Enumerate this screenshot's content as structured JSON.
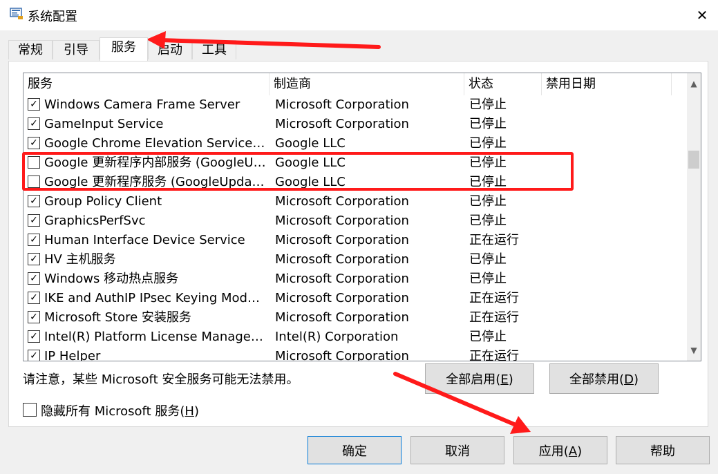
{
  "window": {
    "title": "系统配置",
    "close_glyph": "✕"
  },
  "tabs": [
    {
      "label": "常规"
    },
    {
      "label": "引导"
    },
    {
      "label": "服务"
    },
    {
      "label": "启动"
    },
    {
      "label": "工具"
    }
  ],
  "columns": {
    "service": "服务",
    "manufacturer": "制造商",
    "status": "状态",
    "disabled_date": "禁用日期"
  },
  "services": [
    {
      "name": "Windows Camera Frame Server",
      "manufacturer": "Microsoft Corporation",
      "status": "已停止",
      "checked": true
    },
    {
      "name": "GameInput Service",
      "manufacturer": "Microsoft Corporation",
      "status": "已停止",
      "checked": true
    },
    {
      "name": "Google Chrome Elevation Service (G...",
      "manufacturer": "Google LLC",
      "status": "已停止",
      "checked": true
    },
    {
      "name": "Google 更新程序内部服务 (GoogleUp...",
      "manufacturer": "Google LLC",
      "status": "已停止",
      "checked": false
    },
    {
      "name": "Google 更新程序服务 (GoogleUpdate...",
      "manufacturer": "Google LLC",
      "status": "已停止",
      "checked": false
    },
    {
      "name": "Group Policy Client",
      "manufacturer": "Microsoft Corporation",
      "status": "已停止",
      "checked": true
    },
    {
      "name": "GraphicsPerfSvc",
      "manufacturer": "Microsoft Corporation",
      "status": "已停止",
      "checked": true
    },
    {
      "name": "Human Interface Device Service",
      "manufacturer": "Microsoft Corporation",
      "status": "正在运行",
      "checked": true
    },
    {
      "name": "HV 主机服务",
      "manufacturer": "Microsoft Corporation",
      "status": "已停止",
      "checked": true
    },
    {
      "name": "Windows 移动热点服务",
      "manufacturer": "Microsoft Corporation",
      "status": "已停止",
      "checked": true
    },
    {
      "name": "IKE and AuthIP IPsec Keying Modules",
      "manufacturer": "Microsoft Corporation",
      "status": "正在运行",
      "checked": true
    },
    {
      "name": "Microsoft Store 安装服务",
      "manufacturer": "Microsoft Corporation",
      "status": "正在运行",
      "checked": true
    },
    {
      "name": "Intel(R) Platform License Manager S...",
      "manufacturer": "Intel(R) Corporation",
      "status": "已停止",
      "checked": true
    },
    {
      "name": "IP Helper",
      "manufacturer": "Microsoft Corporation",
      "status": "正在运行",
      "checked": true
    }
  ],
  "note": "请注意，某些 Microsoft 安全服务可能无法禁用。",
  "enable_all": {
    "text": "全部启用(",
    "key": "E",
    "close": ")"
  },
  "disable_all": {
    "text": "全部禁用(",
    "key": "D",
    "close": ")"
  },
  "hide_ms": {
    "text": "隐藏所有 Microsoft 服务(",
    "key": "H",
    "close": ")",
    "checked": false
  },
  "footer": {
    "ok": "确定",
    "cancel": "取消",
    "apply": {
      "text": "应用(",
      "key": "A",
      "close": ")"
    },
    "help": "帮助"
  },
  "colors": {
    "annotation_red": "#ff1a1a",
    "focus_blue": "#0078d7"
  },
  "icons": {
    "scroll_up": "▲",
    "scroll_down": "▼",
    "check": "✓"
  }
}
